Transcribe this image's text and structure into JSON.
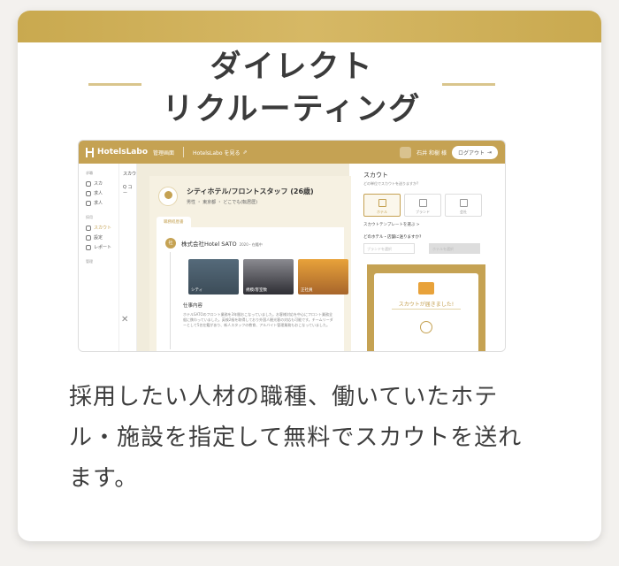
{
  "colors": {
    "gold": "#c5a253",
    "text": "#3b3b3b"
  },
  "headline": [
    "ダイレクト",
    "リクルーティング"
  ],
  "app": {
    "logo": "HotelsLabo",
    "admin_label": "管理画面",
    "view_link": "HotelsLabo を見る",
    "user_name": "石井 和樹 様",
    "logout": "ログアウト"
  },
  "sidebar": {
    "sections": [
      "求職",
      "採用",
      "管理"
    ],
    "items": [
      "スカ",
      "求人",
      "求人",
      "スカウト",
      "設定",
      "レポート"
    ]
  },
  "list_col": [
    "スカウ",
    "Q コー"
  ],
  "profile": {
    "title": "シティホテル/フロントスタッフ (26歳)",
    "meta": "男性 ・ 東京都 ・ どこでも(転居歴)",
    "tab": "職務経歴書",
    "company": "株式会社Hotel SATO",
    "company_date": "2020・在籍中",
    "thumbs": [
      "シティ",
      "規模/客室数",
      "正社員"
    ],
    "job_heading": "仕事内容",
    "job_text": "ホテルSATOのフロント業務を3年間おこなっていました。お客様対応を中心にフロント業務全般に携わっていました。英検2級を取得しており外国人観光客の対応も可能です。チームリーダーとして5名在籍があり、新人スタッフの教育、アルバイト管理業務もおこなっていました。"
  },
  "scout": {
    "title": "スカウト",
    "subtitle": "どの単位でスカウトを送りますか?",
    "tabs": [
      "ホテル",
      "ブランド",
      "会社"
    ],
    "template": "スカウトテンプレートを選ぶ >",
    "question": "どのホテル・店舗に送りますか?",
    "select_a": "ブランドを選択",
    "select_b": "ホテルを選択",
    "done": "スカウトが届きました!"
  },
  "description": "採用したい人材の職種、働いていたホテル・施設を指定して無料でスカウトを送れます。"
}
